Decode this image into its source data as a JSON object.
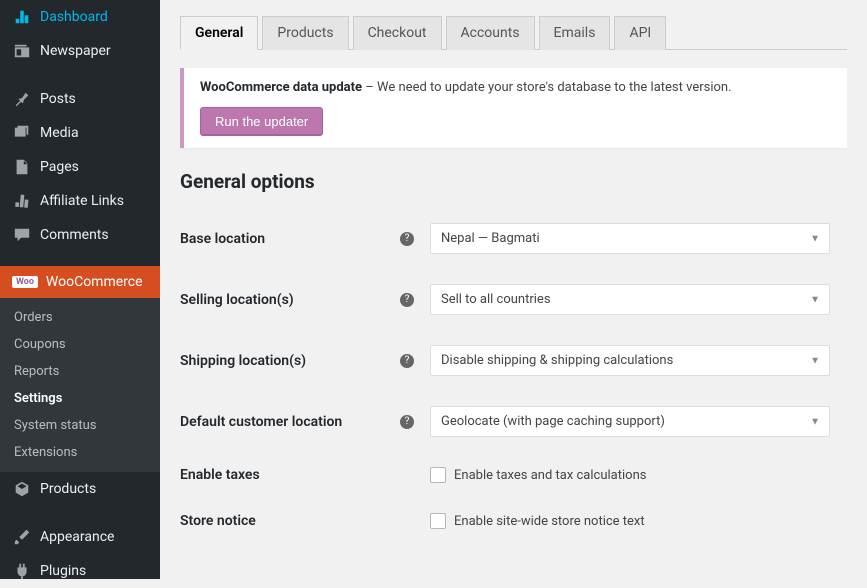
{
  "sidebar": {
    "items": [
      {
        "label": "Dashboard",
        "icon": "dashboard"
      },
      {
        "label": "Newspaper",
        "icon": "newspaper"
      },
      {
        "label": "Posts",
        "icon": "pin"
      },
      {
        "label": "Media",
        "icon": "media"
      },
      {
        "label": "Pages",
        "icon": "page"
      },
      {
        "label": "Affiliate Links",
        "icon": "links"
      },
      {
        "label": "Comments",
        "icon": "comment"
      },
      {
        "label": "WooCommerce",
        "icon": "woo"
      },
      {
        "label": "Products",
        "icon": "product"
      },
      {
        "label": "Appearance",
        "icon": "brush"
      },
      {
        "label": "Plugins",
        "icon": "plug"
      }
    ],
    "submenu": [
      {
        "label": "Orders"
      },
      {
        "label": "Coupons"
      },
      {
        "label": "Reports"
      },
      {
        "label": "Settings"
      },
      {
        "label": "System status"
      },
      {
        "label": "Extensions"
      }
    ],
    "woo_badge": "Woo"
  },
  "tabs": [
    {
      "label": "General"
    },
    {
      "label": "Products"
    },
    {
      "label": "Checkout"
    },
    {
      "label": "Accounts"
    },
    {
      "label": "Emails"
    },
    {
      "label": "API"
    }
  ],
  "notice": {
    "strong": "WooCommerce data update",
    "sep": " – ",
    "text": "We need to update your store's database to the latest version.",
    "button": "Run the updater"
  },
  "section_title": "General options",
  "form": {
    "base_location": {
      "label": "Base location",
      "value": "Nepal — Bagmati"
    },
    "selling": {
      "label": "Selling location(s)",
      "value": "Sell to all countries"
    },
    "shipping": {
      "label": "Shipping location(s)",
      "value": "Disable shipping & shipping calculations"
    },
    "default_customer": {
      "label": "Default customer location",
      "value": "Geolocate (with page caching support)"
    },
    "taxes": {
      "label": "Enable taxes",
      "checkbox_label": "Enable taxes and tax calculations"
    },
    "notice": {
      "label": "Store notice",
      "checkbox_label": "Enable site-wide store notice text"
    }
  }
}
